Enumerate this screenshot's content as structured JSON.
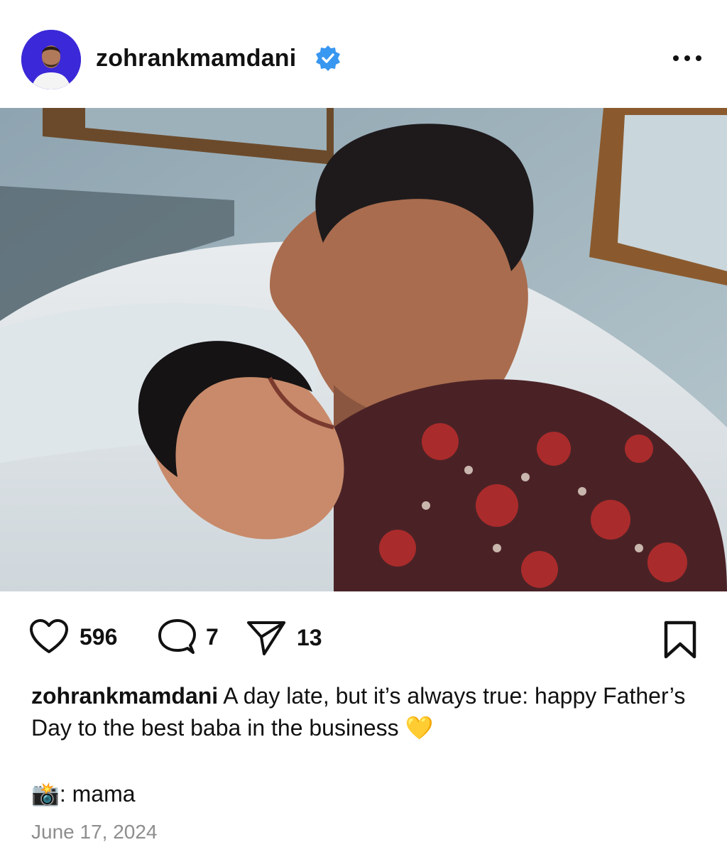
{
  "post": {
    "author": "zohrankmamdani",
    "verified": true,
    "more_icon": "more-horizontal-icon",
    "photo_alt": "",
    "likes": "596",
    "comments": "7",
    "shares": "13",
    "caption_user": "zohrankmamdani",
    "caption_text": " A day late, but it’s always true: happy Father’s Day to the best baba in the business 💛",
    "credit_emoji": "📸",
    "credit_text": ": mama",
    "date": "June 17, 2024"
  },
  "colors": {
    "verified_blue": "#3897f0",
    "avatar_bg": "#3b28d8",
    "date_gray": "#8e8e8e"
  },
  "icons": {
    "like": "heart-outline-icon",
    "comment": "speech-bubble-icon",
    "share": "paper-plane-icon",
    "bookmark": "bookmark-outline-icon"
  }
}
